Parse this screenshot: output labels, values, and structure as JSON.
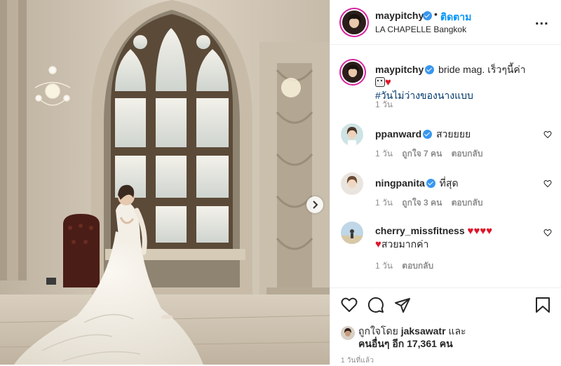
{
  "header": {
    "username": "maypitchy",
    "dot": "•",
    "follow_label": "ติดตาม",
    "location": "LA CHAPELLE Bangkok",
    "more": "..."
  },
  "caption": {
    "username": "maypitchy",
    "text": "bride mag. เร็วๆนี้ค่า",
    "hashtag": "#วันไม่ว่างของนางแบบ",
    "time": "1 วัน"
  },
  "comments": [
    {
      "username": "ppanward",
      "text": "สวยยยย",
      "time": "1 วัน",
      "likes": "ถูกใจ 7 คน",
      "reply": "ตอบกลับ"
    },
    {
      "username": "ningpanita",
      "text": "ที่สุด",
      "time": "1 วัน",
      "likes": "ถูกใจ 3 คน",
      "reply": "ตอบกลับ"
    },
    {
      "username": "cherry_missfitness",
      "text": "สวยมากค่า",
      "time": "1 วัน",
      "reply": "ตอบกลับ"
    }
  ],
  "likes": {
    "prefix": "ถูกใจโดย",
    "user": "jaksawatr",
    "and": "และ",
    "others": "คนอื่นๆ อีก 17,361 คน"
  },
  "post_time": "1 วันที่แล้ว",
  "icons": {
    "verified": "verified-badge-icon",
    "like": "heart-icon",
    "comment": "comment-icon",
    "share": "share-icon",
    "save": "bookmark-icon",
    "next": "chevron-right-icon"
  },
  "colors": {
    "accent": "#0095f6",
    "verified": "#3897f0",
    "heart": "#e0142a",
    "muted": "#8e8e8e"
  }
}
